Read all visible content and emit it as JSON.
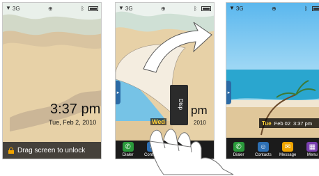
{
  "screen1": {
    "clock_time": "3:37 pm",
    "clock_date": "Tue, Feb 2, 2010",
    "unlock_text": "Drag screen to unlock"
  },
  "screen2": {
    "clock_partial": "pm",
    "date_partial": "2010",
    "day_partial": "Wed",
    "tray_labels": [
      "Dialer",
      "Contacts"
    ],
    "peel_text": "Disp"
  },
  "screen3": {
    "date_day": "Tue",
    "date_text": "Feb 02",
    "date_time": "3:37 pm",
    "tray": [
      {
        "label": "Dialer",
        "icon": "phone-icon",
        "color": "#2a9a3b"
      },
      {
        "label": "Contacts",
        "icon": "contacts-icon",
        "color": "#2d6fb3"
      },
      {
        "label": "Message",
        "icon": "envelope-icon",
        "color": "#f0a500"
      },
      {
        "label": "Menu",
        "icon": "grid-icon",
        "color": "#7a3fb0"
      }
    ]
  },
  "statusbar": {
    "signal_text": "3G"
  },
  "colors": {
    "sand": "#e7d1a7",
    "sea": "#2aa6cf",
    "sky": "#38a7e6",
    "tray": "#1b1b1b",
    "accent_lock": "#f3a500"
  }
}
